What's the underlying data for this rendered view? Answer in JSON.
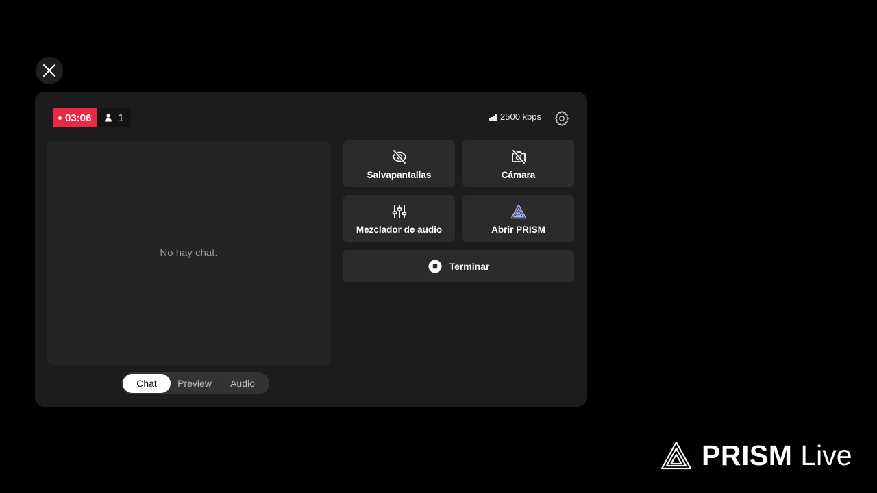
{
  "stream": {
    "elapsed": "03:06",
    "viewers": "1",
    "bitrate": "2500 kbps"
  },
  "chat": {
    "empty_message": "No hay chat."
  },
  "tabs": [
    {
      "label": "Chat",
      "active": true
    },
    {
      "label": "Preview",
      "active": false
    },
    {
      "label": "Audio",
      "active": false
    }
  ],
  "actions": {
    "screensaver": {
      "label": "Salvapantallas",
      "icon": "eye-off-icon"
    },
    "camera": {
      "label": "Cámara",
      "icon": "camera-off-icon"
    },
    "audio_mixer": {
      "label": "Mezclador de audio",
      "icon": "sliders-icon"
    },
    "open_prism": {
      "label": "Abrir PRISM",
      "icon": "prism-logo-icon"
    },
    "end": {
      "label": "Terminar",
      "icon": "stop-icon"
    }
  },
  "brand": {
    "name": "PRISM",
    "suffix": "Live"
  },
  "colors": {
    "live_red": "#ec2845",
    "panel": "#1c1c1c",
    "tile": "#2b2b2b",
    "background": "#000000"
  }
}
